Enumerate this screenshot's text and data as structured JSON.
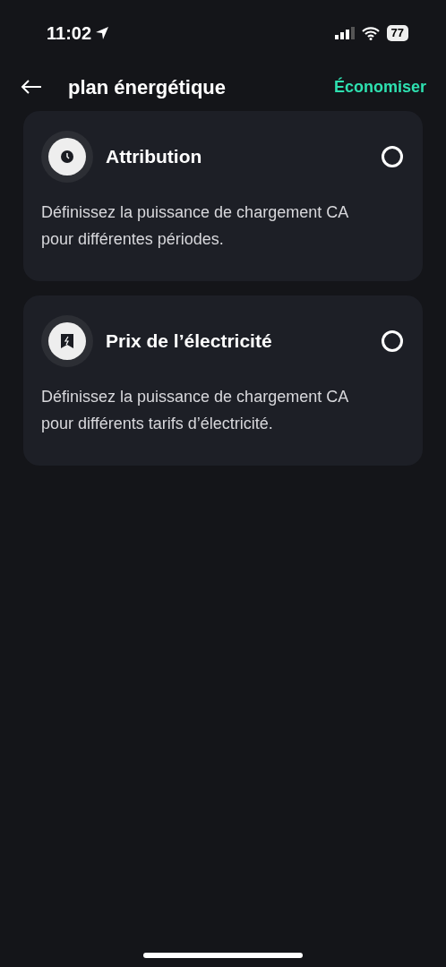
{
  "status_bar": {
    "time": "11:02",
    "battery": "77"
  },
  "header": {
    "title": "plan énergétique",
    "action": "Économiser"
  },
  "options": [
    {
      "kind": "clock",
      "title": "Attribution",
      "description": "Définissez la puissance de chargement CA pour différentes périodes.",
      "selected": false
    },
    {
      "kind": "bolt",
      "title": "Prix de l’électricité",
      "description": "Définissez la puissance de chargement CA pour différents tarifs d’électricité.",
      "selected": false
    }
  ]
}
